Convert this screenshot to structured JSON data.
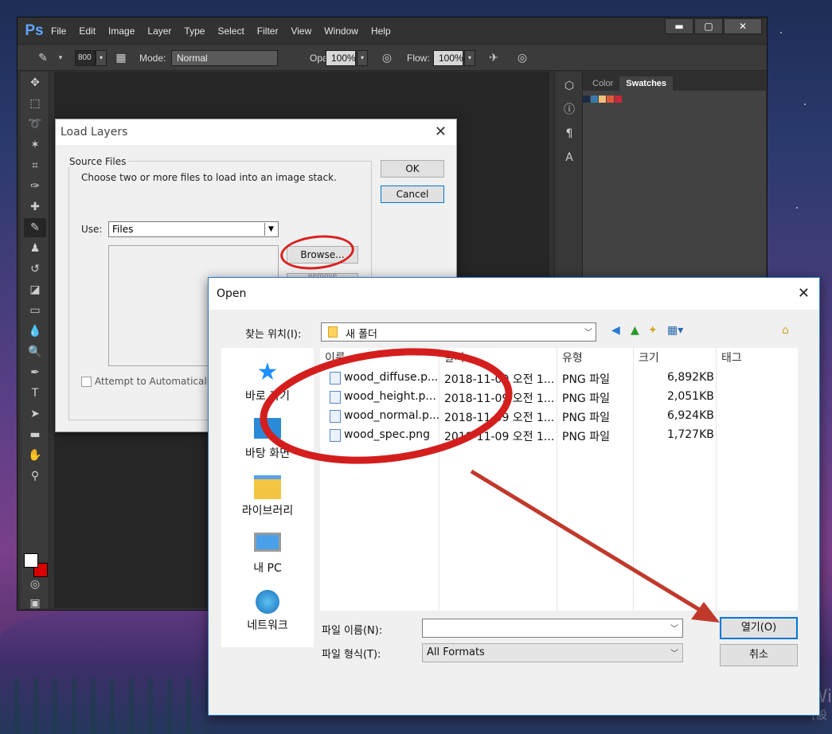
{
  "photoshop": {
    "logo": "Ps",
    "menu": [
      "File",
      "Edit",
      "Image",
      "Layer",
      "Type",
      "Select",
      "Filter",
      "View",
      "Window",
      "Help"
    ],
    "options": {
      "brush_size": "800",
      "mode_label": "Mode:",
      "mode_value": "Normal",
      "opacity_label": "Opacity:",
      "opacity_value": "100%",
      "flow_label": "Flow:",
      "flow_value": "100%"
    },
    "panel_tabs": [
      "Color",
      "Swatches"
    ],
    "swatch_colors": [
      "#1b2d45",
      "#3b78a8",
      "#f0c07a",
      "#e05a3a",
      "#c8283a"
    ]
  },
  "load_layers": {
    "title": "Load Layers",
    "group_label": "Source Files",
    "description": "Choose two or more files to load into an image stack.",
    "use_label": "Use:",
    "use_value": "Files",
    "browse": "Browse...",
    "remove": "Remove",
    "ok": "OK",
    "cancel": "Cancel",
    "attempt_label": "Attempt to Automatically"
  },
  "open_dialog": {
    "title": "Open",
    "look_in_label": "찾는 위치(I):",
    "look_in_value": "새 폴더",
    "places": [
      "바로 가기",
      "바탕 화면",
      "라이브러리",
      "내 PC",
      "네트워크"
    ],
    "columns": [
      "이름",
      "날짜",
      "유형",
      "크기",
      "태그"
    ],
    "files": [
      {
        "name": "wood_diffuse.p...",
        "date": "2018-11-09 오전 1...",
        "type": "PNG 파일",
        "size": "6,892KB"
      },
      {
        "name": "wood_height.p...",
        "date": "2018-11-09 오전 1...",
        "type": "PNG 파일",
        "size": "2,051KB"
      },
      {
        "name": "wood_normal.p...",
        "date": "2018-11-09 오전 1...",
        "type": "PNG 파일",
        "size": "6,924KB"
      },
      {
        "name": "wood_spec.png",
        "date": "2018-11-09 오전 1...",
        "type": "PNG 파일",
        "size": "1,727KB"
      }
    ],
    "filename_label": "파일 이름(N):",
    "filename_value": "",
    "filetype_label": "파일 형식(T):",
    "filetype_value": "All Formats",
    "open_button": "열기(O)",
    "cancel_button": "취소"
  },
  "desktop": {
    "watermark": "Wi",
    "watermark_sub": "[設"
  }
}
